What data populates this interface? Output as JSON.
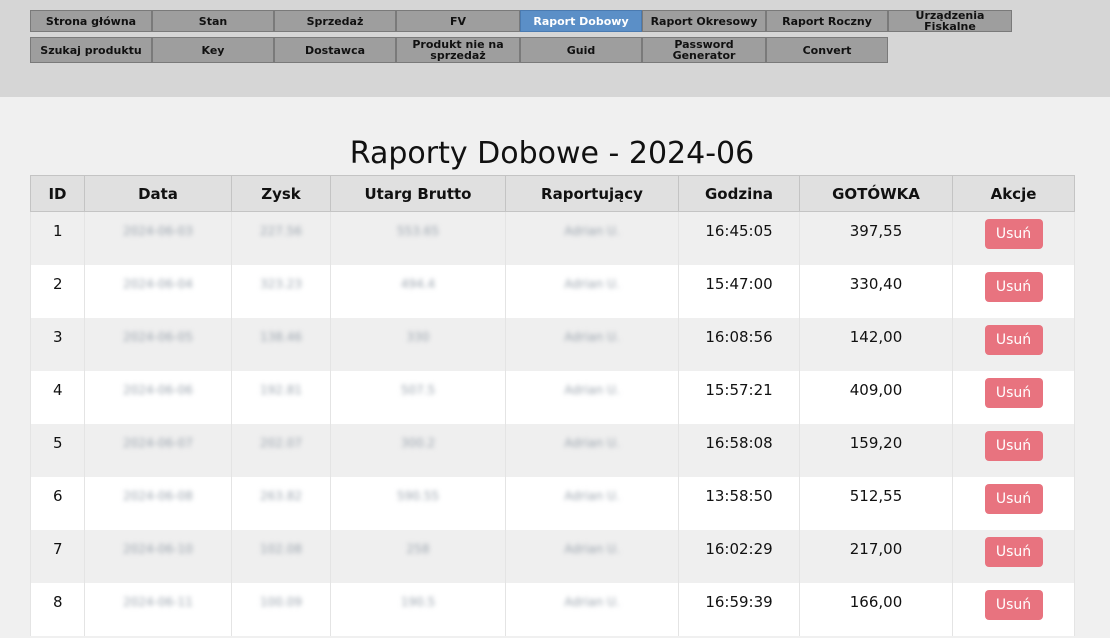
{
  "nav": {
    "row1": [
      {
        "label": "Strona główna",
        "active": false
      },
      {
        "label": "Stan",
        "active": false
      },
      {
        "label": "Sprzedaż",
        "active": false
      },
      {
        "label": "FV",
        "active": false
      },
      {
        "label": "Raport Dobowy",
        "active": true
      },
      {
        "label": "Raport Okresowy",
        "active": false
      },
      {
        "label": "Raport Roczny",
        "active": false
      },
      {
        "label": "Urządzenia Fiskalne",
        "active": false
      }
    ],
    "row2": [
      {
        "label": "Szukaj produktu",
        "active": false
      },
      {
        "label": "Key",
        "active": false
      },
      {
        "label": "Dostawca",
        "active": false
      },
      {
        "label": "Produkt nie na sprzedaż",
        "active": false
      },
      {
        "label": "Guid",
        "active": false
      },
      {
        "label": "Password Generator",
        "active": false
      },
      {
        "label": "Convert",
        "active": false
      }
    ]
  },
  "page": {
    "title": "Raporty Dobowe - 2024-06"
  },
  "table": {
    "headers": [
      "ID",
      "Data",
      "Zysk",
      "Utarg Brutto",
      "Raportujący",
      "Godzina",
      "GOTÓWKA",
      "Akcje"
    ],
    "delete_label": "Usuń",
    "rows": [
      {
        "id": "1",
        "date": "2024-06-03",
        "profit": "227.56",
        "gross": "553.65",
        "reporter": "Adrian U.",
        "time": "16:45:05",
        "cash": "397,55"
      },
      {
        "id": "2",
        "date": "2024-06-04",
        "profit": "323.23",
        "gross": "494.4",
        "reporter": "Adrian U.",
        "time": "15:47:00",
        "cash": "330,40"
      },
      {
        "id": "3",
        "date": "2024-06-05",
        "profit": "138.46",
        "gross": "330",
        "reporter": "Adrian U.",
        "time": "16:08:56",
        "cash": "142,00"
      },
      {
        "id": "4",
        "date": "2024-06-06",
        "profit": "192.81",
        "gross": "507.5",
        "reporter": "Adrian U.",
        "time": "15:57:21",
        "cash": "409,00"
      },
      {
        "id": "5",
        "date": "2024-06-07",
        "profit": "202.07",
        "gross": "300.2",
        "reporter": "Adrian U.",
        "time": "16:58:08",
        "cash": "159,20"
      },
      {
        "id": "6",
        "date": "2024-06-08",
        "profit": "263.82",
        "gross": "590.55",
        "reporter": "Adrian U.",
        "time": "13:58:50",
        "cash": "512,55"
      },
      {
        "id": "7",
        "date": "2024-06-10",
        "profit": "102.08",
        "gross": "258",
        "reporter": "Adrian U.",
        "time": "16:02:29",
        "cash": "217,00"
      },
      {
        "id": "8",
        "date": "2024-06-11",
        "profit": "100.09",
        "gross": "190.5",
        "reporter": "Adrian U.",
        "time": "16:59:39",
        "cash": "166,00"
      }
    ]
  },
  "colors": {
    "nav_button": "#9e9e9e",
    "nav_active": "#5b8fc7",
    "delete_button": "#e8737f"
  }
}
